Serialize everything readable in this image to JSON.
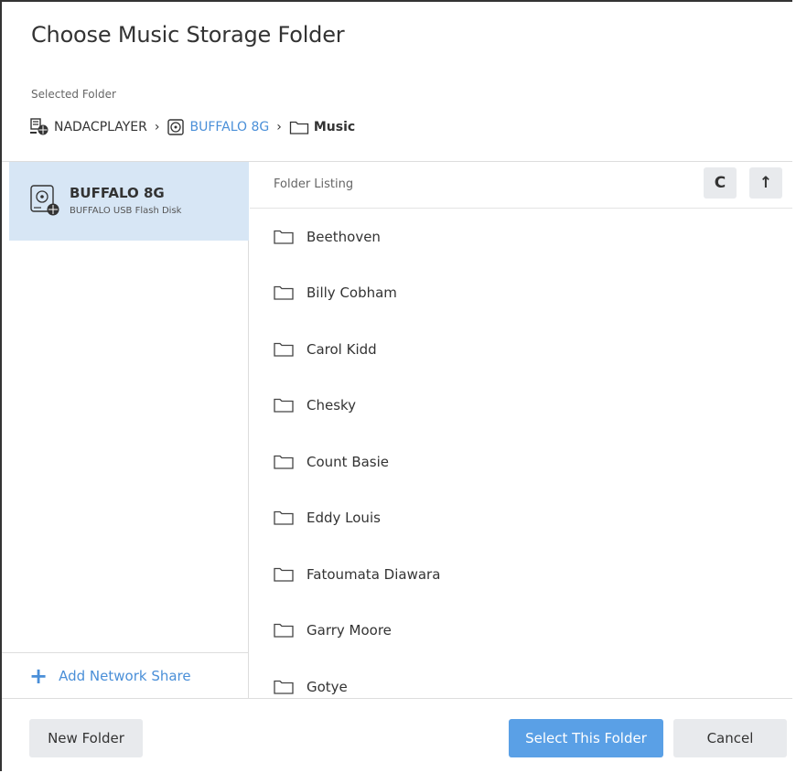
{
  "dialog": {
    "title": "Choose Music Storage Folder"
  },
  "selected": {
    "label": "Selected Folder",
    "breadcrumb": [
      {
        "label": "NADACPLAYER",
        "icon": "computer-network-icon"
      },
      {
        "label": "BUFFALO 8G",
        "icon": "disk-icon"
      },
      {
        "label": "Music",
        "icon": "folder-icon"
      }
    ],
    "separator": "›"
  },
  "sidebar": {
    "drive": {
      "name": "BUFFALO 8G",
      "description": "BUFFALO USB Flash Disk",
      "icon": "usb-disk-icon"
    },
    "add_share_label": "Add Network Share",
    "add_icon": "+"
  },
  "listing": {
    "header": "Folder Listing",
    "refresh_icon": "C",
    "up_icon": "↑",
    "folders": [
      "Beethoven",
      "Billy Cobham",
      "Carol Kidd",
      "Chesky",
      "Count Basie",
      "Eddy Louis",
      "Fatoumata Diawara",
      "Garry Moore",
      "Gotye"
    ]
  },
  "footer": {
    "new_folder": "New Folder",
    "select_folder": "Select This Folder",
    "cancel": "Cancel"
  },
  "colors": {
    "accent": "#4a8fd8",
    "primary_button": "#5aa0e6",
    "selected_bg": "#d7e6f5"
  }
}
